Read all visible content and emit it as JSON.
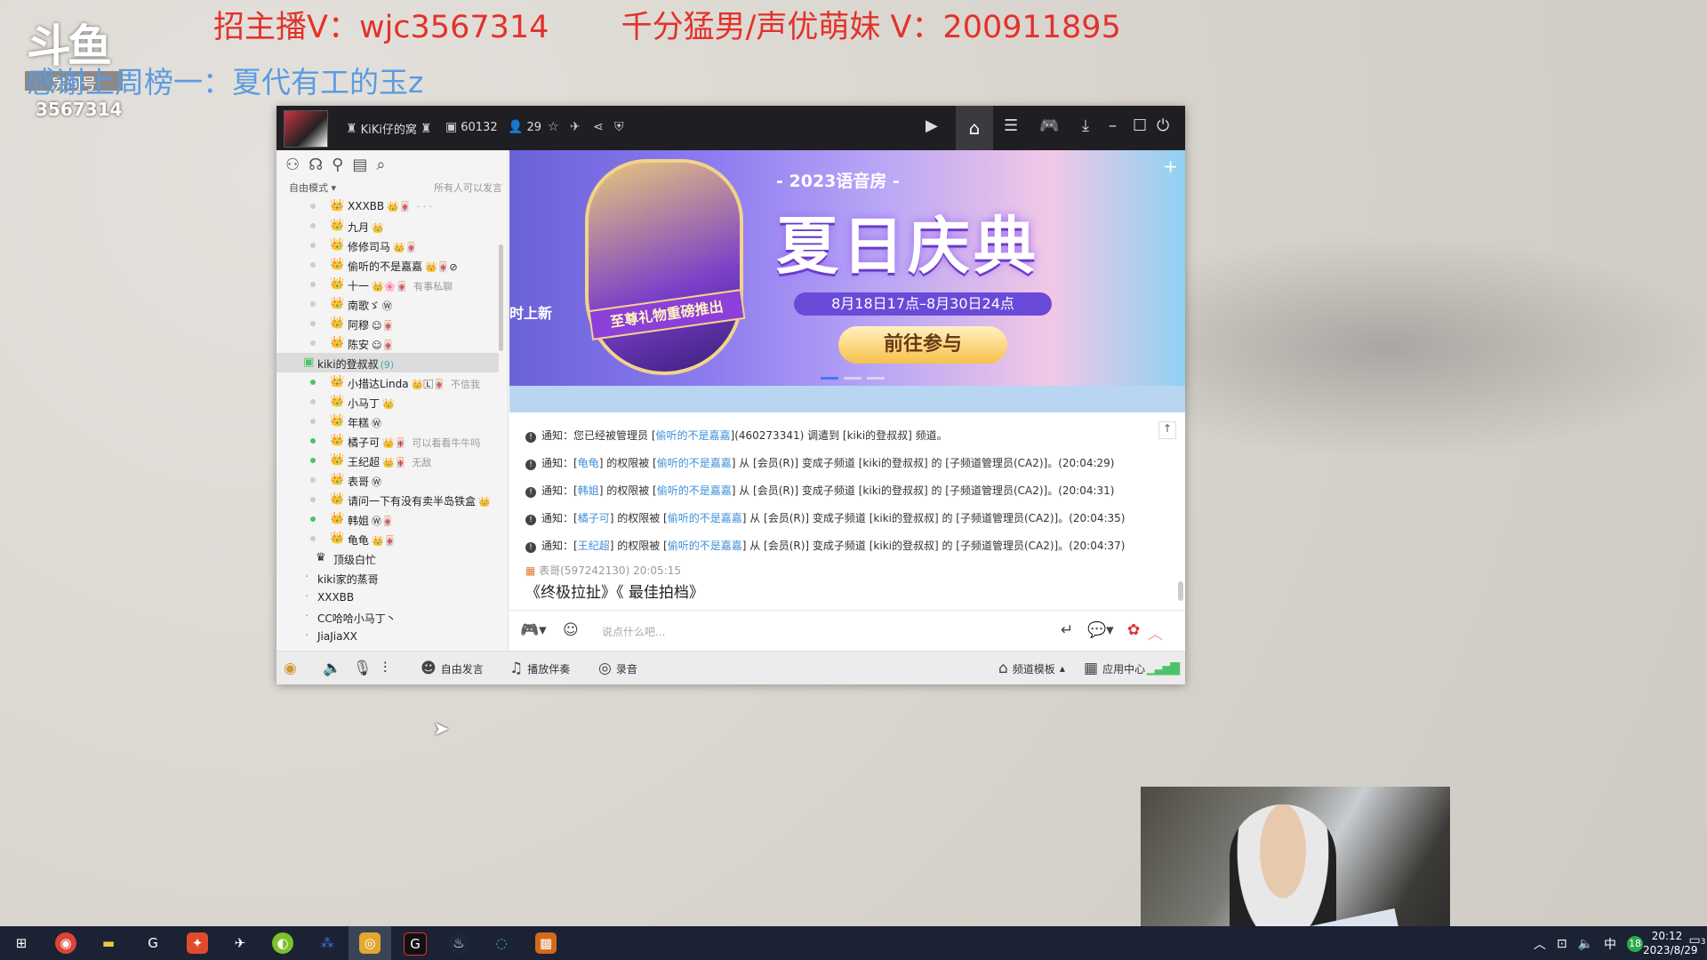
{
  "overlay": {
    "recruit_host": "招主播V：wjc3567314",
    "recruit_voice": "千分猛男/声优萌妹 V：200911895",
    "rank_line": "感谢上周榜一：夏代有工的玉z",
    "logo_text": "斗鱼",
    "logo_sub": "房间号",
    "room_number": "3567314"
  },
  "titlebar": {
    "channel_name": "KiKi仔的窝",
    "channel_id": "60132",
    "online_count": "29"
  },
  "left_panel": {
    "mode_label": "自由模式 ▾",
    "speak_permission": "所有人可以发言",
    "users": [
      {
        "name": "XXXBB",
        "badge": "👑🀄",
        "note": "· · ·",
        "online": false,
        "crown": "👑"
      },
      {
        "name": "九月",
        "badge": "👑",
        "note": "",
        "online": false,
        "crown": "👑"
      },
      {
        "name": "修修司马",
        "badge": "👑🀄",
        "note": "",
        "online": false,
        "crown": "👑"
      },
      {
        "name": "偷听的不是嘉嘉",
        "badge": "👑🀄⊘",
        "note": "",
        "online": false,
        "crown": "👑"
      },
      {
        "name": "十一",
        "badge": "👑🌸🀄",
        "note": "有事私聊",
        "online": false,
        "crown": "👑"
      },
      {
        "name": "南歌ゞ",
        "badge": "Ⓦ",
        "note": "",
        "online": false,
        "crown": "👑"
      },
      {
        "name": "阿穆",
        "badge": "☺🀄",
        "note": "",
        "online": false,
        "crown": "👑"
      },
      {
        "name": "陈安",
        "badge": "☺🀄",
        "note": "",
        "online": false,
        "crown": "👑"
      }
    ],
    "subchannel": "kiki的登叔叔",
    "subchannel_count": "(9)",
    "sub_users": [
      {
        "name": "小措达Linda",
        "badge": "👑🄻🀄",
        "note": "不信我",
        "online": true
      },
      {
        "name": "小马丁",
        "badge": "👑",
        "note": "",
        "online": false
      },
      {
        "name": "年糕",
        "badge": "Ⓦ",
        "note": "",
        "online": false
      },
      {
        "name": "橘子可",
        "badge": "👑🀄",
        "note": "可以看看牛牛吗",
        "online": true
      },
      {
        "name": "王纪超",
        "badge": "👑🀄",
        "note": "无敌",
        "online": true
      },
      {
        "name": "表哥",
        "badge": "Ⓦ",
        "note": "",
        "online": false
      },
      {
        "name": "请问一下有没有卖半岛铁盒",
        "badge": "👑",
        "note": "",
        "online": false
      },
      {
        "name": "韩姐",
        "badge": "Ⓦ🀄",
        "note": "",
        "online": true
      },
      {
        "name": "龟龟",
        "badge": "👑🀄",
        "note": "",
        "online": false
      }
    ],
    "groups": [
      "顶级白忙",
      "kiki家的蒸哥",
      "XXXBB",
      "CC哈哈小马丁丶",
      "JiaJiaXX"
    ]
  },
  "banner": {
    "subtitle": "- 2023语音房 -",
    "title": "夏日庆典",
    "date_range": "8月18日17点–8月30日24点",
    "cta": "前往参与",
    "promo": "至尊礼物重磅推出",
    "left_tag": "时上新"
  },
  "messages": [
    {
      "prefix": "通知：您已经被管理员 [",
      "user": "偷听的不是嘉嘉",
      "rest": "](460273341) 调遣到 [kiki的登叔叔] 频道。"
    },
    {
      "prefix": "通知：[",
      "user": "龟龟",
      "mid": "] 的权限被 [",
      "by": "偷听的不是嘉嘉",
      "rest": "] 从 [会员(R)] 变成子频道 [kiki的登叔叔] 的 [子频道管理员(CA2)]。(20:04:29)"
    },
    {
      "prefix": "通知：[",
      "user": "韩姐",
      "mid": "] 的权限被 [",
      "by": "偷听的不是嘉嘉",
      "rest": "] 从 [会员(R)] 变成子频道 [kiki的登叔叔] 的 [子频道管理员(CA2)]。(20:04:31)"
    },
    {
      "prefix": "通知：[",
      "user": "橘子可",
      "mid": "] 的权限被 [",
      "by": "偷听的不是嘉嘉",
      "rest": "] 从 [会员(R)] 变成子频道 [kiki的登叔叔] 的 [子频道管理员(CA2)]。(20:04:35)"
    },
    {
      "prefix": "通知：[",
      "user": "王纪超",
      "mid": "] 的权限被 [",
      "by": "偷听的不是嘉嘉",
      "rest": "] 从 [会员(R)] 变成子频道 [kiki的登叔叔] 的 [子频道管理员(CA2)]。(20:04:37)"
    }
  ],
  "chat": {
    "sender": "表哥(597242130)",
    "time": "20:05:15",
    "text": "《终极拉扯》《 最佳拍档》"
  },
  "input": {
    "placeholder": "说点什么吧..."
  },
  "bottom_bar": {
    "free_speak": "自由发言",
    "music": "播放伴奏",
    "record": "录音",
    "template": "频道模板",
    "app_center": "应用中心"
  },
  "taskbar": {
    "ime": "中",
    "badge_count": "18",
    "time": "20:12",
    "date": "2023/8/29",
    "notif_count": "3"
  },
  "colors": {
    "accent_link": "#3d8fd8",
    "online": "#4cc36a",
    "overlay_red": "#e3322a",
    "overlay_blue": "#5b9be0"
  }
}
